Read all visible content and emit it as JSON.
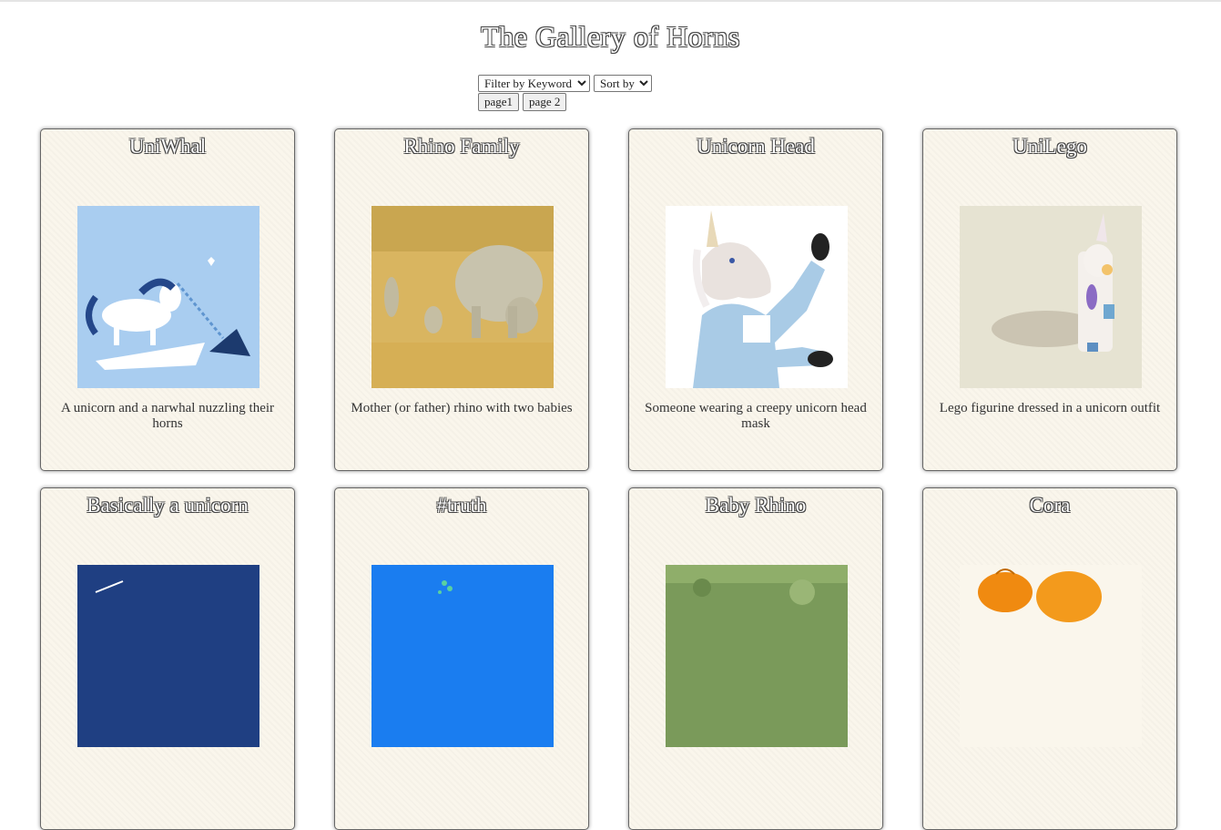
{
  "page_title": "The Gallery of Horns",
  "controls": {
    "filter_label": "Filter by Keyword",
    "sort_label": "Sort by",
    "page_buttons": [
      "page1",
      "page 2"
    ]
  },
  "cards": [
    {
      "title": "UniWhal",
      "description": "A unicorn and a narwhal nuzzling their horns",
      "image_icon": "unicorn-narwhal-illustration"
    },
    {
      "title": "Rhino Family",
      "description": "Mother (or father) rhino with two babies",
      "image_icon": "rhino-family-photo"
    },
    {
      "title": "Unicorn Head",
      "description": "Someone wearing a creepy unicorn head mask",
      "image_icon": "unicorn-mask-photo"
    },
    {
      "title": "UniLego",
      "description": "Lego figurine dressed in a unicorn outfit",
      "image_icon": "lego-unicorn-photo"
    },
    {
      "title": "Basically a unicorn",
      "description": "",
      "image_icon": "narwhal-blue-illustration"
    },
    {
      "title": "#truth",
      "description": "",
      "image_icon": "blue-cartoon-image"
    },
    {
      "title": "Baby Rhino",
      "description": "",
      "image_icon": "baby-rhino-photo"
    },
    {
      "title": "Cora",
      "description": "",
      "image_icon": "orange-toy-image"
    }
  ]
}
